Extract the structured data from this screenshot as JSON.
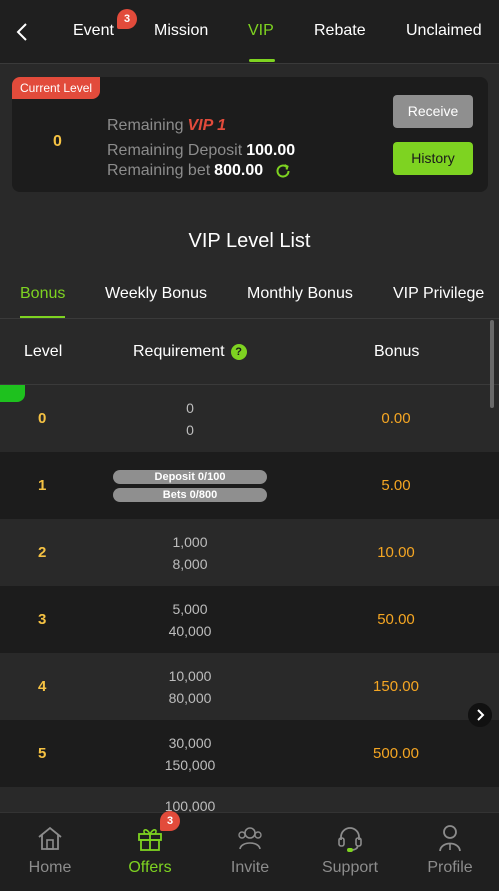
{
  "topnav": {
    "tabs": [
      {
        "label": "Event",
        "badge": "3"
      },
      {
        "label": "Mission"
      },
      {
        "label": "VIP",
        "active": true
      },
      {
        "label": "Rebate"
      },
      {
        "label": "Unclaimed"
      }
    ]
  },
  "current": {
    "tag": "Current Level",
    "level": "0",
    "remaining_label": "Remaining",
    "remaining_vip": "VIP 1",
    "deposit_label": "Remaining Deposit",
    "deposit_value": "100.00",
    "bet_label": "Remaining bet",
    "bet_value": "800.00",
    "receive_label": "Receive",
    "history_label": "History"
  },
  "section_title": "VIP Level List",
  "subtabs": [
    "Bonus",
    "Weekly Bonus",
    "Monthly Bonus",
    "VIP Privilege"
  ],
  "table": {
    "headers": {
      "level": "Level",
      "requirement": "Requirement",
      "bonus": "Bonus"
    },
    "help_glyph": "?",
    "rows": [
      {
        "level": "0",
        "req1": "0",
        "req2": "0",
        "bonus": "0.00"
      },
      {
        "level": "1",
        "pill1": "Deposit 0/100",
        "pill2": "Bets 0/800",
        "bonus": "5.00"
      },
      {
        "level": "2",
        "req1": "1,000",
        "req2": "8,000",
        "bonus": "10.00"
      },
      {
        "level": "3",
        "req1": "5,000",
        "req2": "40,000",
        "bonus": "50.00"
      },
      {
        "level": "4",
        "req1": "10,000",
        "req2": "80,000",
        "bonus": "150.00"
      },
      {
        "level": "5",
        "req1": "30,000",
        "req2": "150,000",
        "bonus": "500.00"
      },
      {
        "level": "",
        "req1": "100,000",
        "req2": "",
        "bonus": ""
      }
    ]
  },
  "bottomnav": {
    "items": [
      {
        "label": "Home",
        "icon": "home-icon"
      },
      {
        "label": "Offers",
        "icon": "gift-icon",
        "badge": "3",
        "active": true
      },
      {
        "label": "Invite",
        "icon": "invite-icon"
      },
      {
        "label": "Support",
        "icon": "headset-icon"
      },
      {
        "label": "Profile",
        "icon": "profile-icon"
      }
    ]
  },
  "colors": {
    "accent": "#7ed321",
    "danger": "#e24b3b",
    "gold": "#f5c243",
    "bonus": "#f5a623"
  }
}
